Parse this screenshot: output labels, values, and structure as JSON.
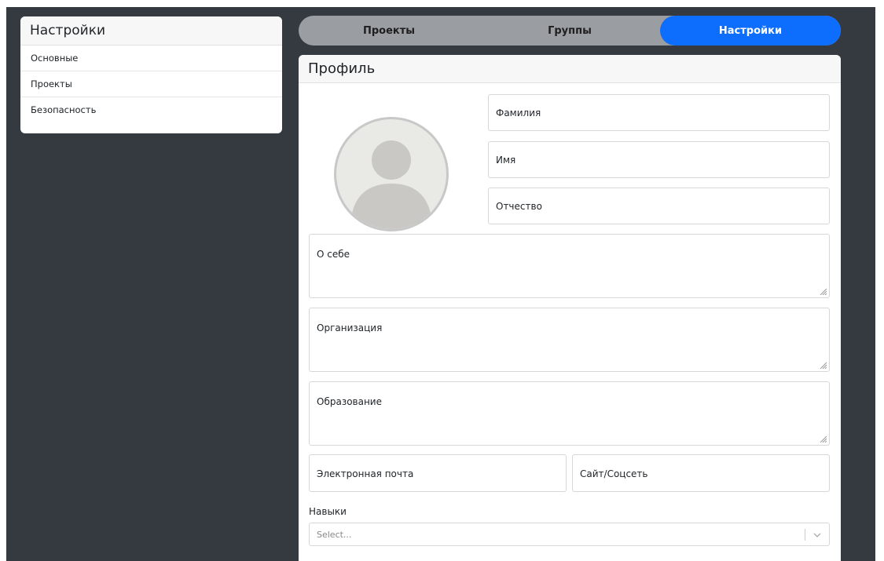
{
  "sidebar": {
    "title": "Настройки",
    "items": [
      {
        "label": "Основные"
      },
      {
        "label": "Проекты"
      },
      {
        "label": "Безопасность"
      }
    ]
  },
  "tabs": [
    {
      "label": "Проекты",
      "active": false
    },
    {
      "label": "Группы",
      "active": false
    },
    {
      "label": "Настройки",
      "active": true
    }
  ],
  "profile": {
    "title": "Профиль",
    "avatar_icon": "user-silhouette-icon",
    "last_name_placeholder": "Фамилия",
    "first_name_placeholder": "Имя",
    "middle_name_placeholder": "Отчество",
    "about_placeholder": "О себе",
    "organization_placeholder": "Организация",
    "education_placeholder": "Образование",
    "email_placeholder": "Электронная почта",
    "website_placeholder": "Сайт/Соцсеть",
    "skills_label": "Навыки",
    "skills_select_placeholder": "Select..."
  },
  "colors": {
    "background": "#343a40",
    "active_tab": "#0d6efd",
    "tab_bar": "#9a9ea3"
  }
}
